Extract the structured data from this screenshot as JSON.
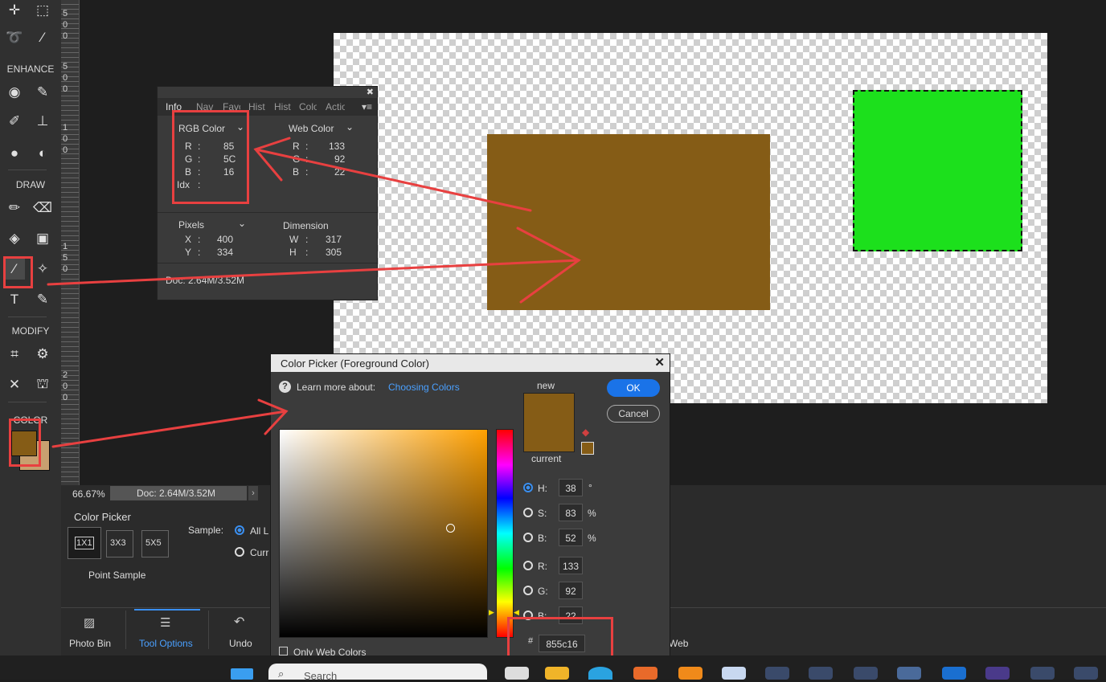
{
  "toolbar": {
    "sections": {
      "enhance": "ENHANCE",
      "draw": "DRAW",
      "modify": "MODIFY",
      "color": "COLOR"
    }
  },
  "ruler": {
    "digits": [
      "5",
      "0",
      "0",
      "5",
      "0",
      "0",
      "1",
      "0",
      "0",
      "1",
      "5",
      "0",
      "2",
      "0",
      "0"
    ]
  },
  "info_panel": {
    "tabs": [
      "Info",
      "Nav",
      "Favo",
      "Hist",
      "Hist",
      "Colo",
      "Actio"
    ],
    "rgb_dropdown": "RGB Color",
    "web_dropdown": "Web Color",
    "rgb": {
      "r_label": "R",
      "r": "85",
      "g_label": "G",
      "g": "5C",
      "b_label": "B",
      "b": "16",
      "idx_label": "Idx"
    },
    "web": {
      "r_label": "R",
      "r": "133",
      "g_label": "G",
      "g": "92",
      "b_label": "B",
      "b": "22"
    },
    "pixels_dropdown": "Pixels",
    "dimension_label": "Dimension",
    "pos": {
      "x_label": "X",
      "x": "400",
      "y_label": "Y",
      "y": "334"
    },
    "dim": {
      "w_label": "W",
      "w": "317",
      "h_label": "H",
      "h": "305"
    },
    "doc": "Doc: 2.64M/3.52M"
  },
  "color_picker": {
    "title": "Color Picker (Foreground Color)",
    "learn_more": "Learn more about:",
    "link": "Choosing Colors",
    "new_label": "new",
    "current_label": "current",
    "ok": "OK",
    "cancel": "Cancel",
    "h_label": "H:",
    "h": "38",
    "h_unit": "°",
    "s_label": "S:",
    "s": "83",
    "s_unit": "%",
    "b_label": "B:",
    "b": "52",
    "b_unit": "%",
    "r_label": "R:",
    "r": "133",
    "g_label": "G:",
    "g": "92",
    "bl_label": "B:",
    "bl": "22",
    "hash": "#",
    "hex": "855c16",
    "only_web": "Only Web Colors"
  },
  "colors": {
    "foreground": "#855c16",
    "background": "#c8a070",
    "accent": "#3a8ff0",
    "green": "#1ce01c",
    "annotation": "#e84040"
  },
  "status": {
    "zoom": "66.67%",
    "doc": "Doc: 2.64M/3.52M"
  },
  "tool_options": {
    "tool_name": "Color Picker",
    "sizes": [
      "1X1",
      "3X3",
      "5X5"
    ],
    "point_sample": "Point Sample",
    "sample_label": "Sample:",
    "sample_all": "All L",
    "sample_curr": "Curr"
  },
  "bottom_tabs": {
    "photo_bin": "Photo Bin",
    "tool_options": "Tool Options",
    "undo": "Undo",
    "web": "Web"
  },
  "taskbar": {
    "search": "Search"
  }
}
